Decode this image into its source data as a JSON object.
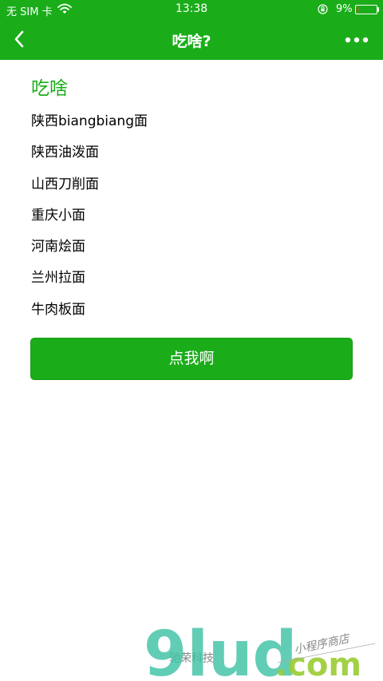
{
  "status_bar": {
    "carrier": "无 SIM 卡",
    "time": "13:38",
    "battery_percent_text": "9%",
    "battery_level": 0.09,
    "battery_color": "#ff3b30",
    "wifi_icon": "wifi-icon",
    "lock_icon": "orientation-lock-icon"
  },
  "nav": {
    "title": "吃啥?",
    "back_icon": "back-chevron-icon",
    "more_icon": "more-dots-icon"
  },
  "main": {
    "heading": "吃啥",
    "items": [
      "陕西biangbiang面",
      "陕西油泼面",
      "山西刀削面",
      "重庆小面",
      "河南烩面",
      "兰州拉面",
      "牛肉板面"
    ],
    "button_label": "点我啊"
  },
  "footer": {
    "text": "驰荣科技"
  },
  "watermark": {
    "logo_text": "9lud",
    "domain_text": ".com",
    "tagline": "小程序商店"
  },
  "colors": {
    "brand": "#1aad19",
    "text": "#000000",
    "background": "#ffffff"
  }
}
